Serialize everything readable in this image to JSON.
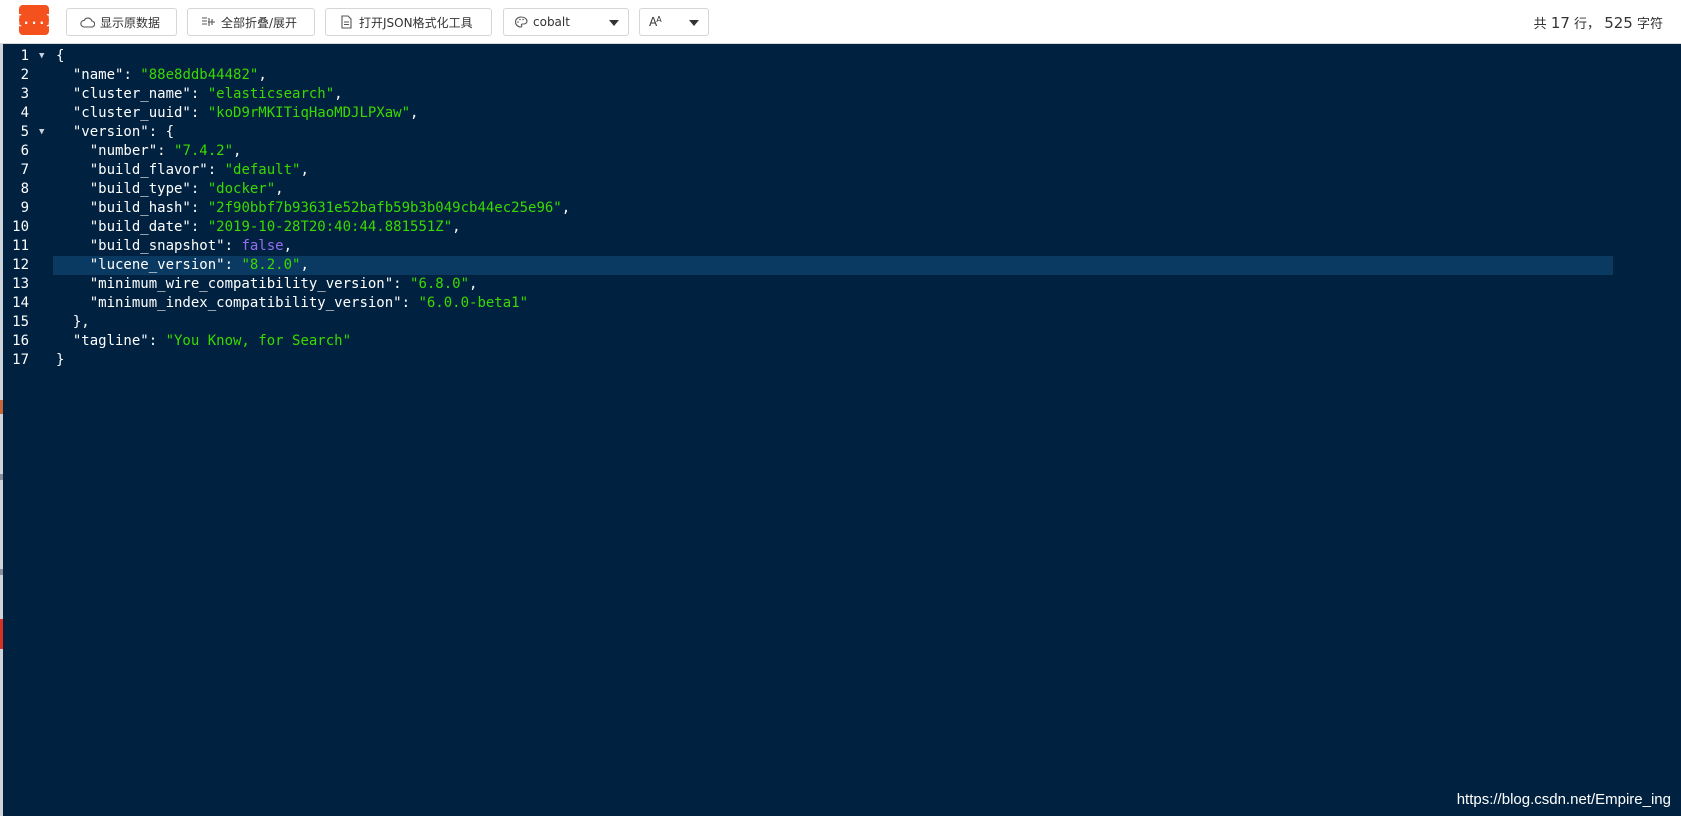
{
  "toolbar": {
    "logo_text": "{...}",
    "show_raw_label": "显示原数据",
    "fold_all_label": "全部折叠/展开",
    "open_tool_label": "打开JSON格式化工具",
    "theme_value": "cobalt",
    "font_value": "A",
    "stats": {
      "prefix": "共",
      "lines": "17",
      "lines_unit": "行，",
      "chars": "525",
      "chars_unit": "字符"
    }
  },
  "editor": {
    "active_line": 12,
    "lines": [
      {
        "n": "1",
        "fold": true,
        "indent": "",
        "parts": [
          {
            "t": "p",
            "v": "{"
          }
        ]
      },
      {
        "n": "2",
        "fold": false,
        "indent": "  ",
        "parts": [
          {
            "t": "k",
            "v": "\"name\""
          },
          {
            "t": "p",
            "v": ": "
          },
          {
            "t": "s",
            "v": "\"88e8ddb44482\""
          },
          {
            "t": "p",
            "v": ","
          }
        ]
      },
      {
        "n": "3",
        "fold": false,
        "indent": "  ",
        "parts": [
          {
            "t": "k",
            "v": "\"cluster_name\""
          },
          {
            "t": "p",
            "v": ": "
          },
          {
            "t": "s",
            "v": "\"elasticsearch\""
          },
          {
            "t": "p",
            "v": ","
          }
        ]
      },
      {
        "n": "4",
        "fold": false,
        "indent": "  ",
        "parts": [
          {
            "t": "k",
            "v": "\"cluster_uuid\""
          },
          {
            "t": "p",
            "v": ": "
          },
          {
            "t": "s",
            "v": "\"koD9rMKITiqHaoMDJLPXaw\""
          },
          {
            "t": "p",
            "v": ","
          }
        ]
      },
      {
        "n": "5",
        "fold": true,
        "indent": "  ",
        "parts": [
          {
            "t": "k",
            "v": "\"version\""
          },
          {
            "t": "p",
            "v": ": {"
          }
        ]
      },
      {
        "n": "6",
        "fold": false,
        "indent": "    ",
        "parts": [
          {
            "t": "k",
            "v": "\"number\""
          },
          {
            "t": "p",
            "v": ": "
          },
          {
            "t": "s",
            "v": "\"7.4.2\""
          },
          {
            "t": "p",
            "v": ","
          }
        ]
      },
      {
        "n": "7",
        "fold": false,
        "indent": "    ",
        "parts": [
          {
            "t": "k",
            "v": "\"build_flavor\""
          },
          {
            "t": "p",
            "v": ": "
          },
          {
            "t": "s",
            "v": "\"default\""
          },
          {
            "t": "p",
            "v": ","
          }
        ]
      },
      {
        "n": "8",
        "fold": false,
        "indent": "    ",
        "parts": [
          {
            "t": "k",
            "v": "\"build_type\""
          },
          {
            "t": "p",
            "v": ": "
          },
          {
            "t": "s",
            "v": "\"docker\""
          },
          {
            "t": "p",
            "v": ","
          }
        ]
      },
      {
        "n": "9",
        "fold": false,
        "indent": "    ",
        "parts": [
          {
            "t": "k",
            "v": "\"build_hash\""
          },
          {
            "t": "p",
            "v": ": "
          },
          {
            "t": "s",
            "v": "\"2f90bbf7b93631e52bafb59b3b049cb44ec25e96\""
          },
          {
            "t": "p",
            "v": ","
          }
        ]
      },
      {
        "n": "10",
        "fold": false,
        "indent": "    ",
        "parts": [
          {
            "t": "k",
            "v": "\"build_date\""
          },
          {
            "t": "p",
            "v": ": "
          },
          {
            "t": "s",
            "v": "\"2019-10-28T20:40:44.881551Z\""
          },
          {
            "t": "p",
            "v": ","
          }
        ]
      },
      {
        "n": "11",
        "fold": false,
        "indent": "    ",
        "parts": [
          {
            "t": "k",
            "v": "\"build_snapshot\""
          },
          {
            "t": "p",
            "v": ": "
          },
          {
            "t": "b",
            "v": "false"
          },
          {
            "t": "p",
            "v": ","
          }
        ]
      },
      {
        "n": "12",
        "fold": false,
        "indent": "    ",
        "parts": [
          {
            "t": "k",
            "v": "\"lucene_version\""
          },
          {
            "t": "p",
            "v": ": "
          },
          {
            "t": "s",
            "v": "\"8.2.0\""
          },
          {
            "t": "p",
            "v": ","
          }
        ]
      },
      {
        "n": "13",
        "fold": false,
        "indent": "    ",
        "parts": [
          {
            "t": "k",
            "v": "\"minimum_wire_compatibility_version\""
          },
          {
            "t": "p",
            "v": ": "
          },
          {
            "t": "s",
            "v": "\"6.8.0\""
          },
          {
            "t": "p",
            "v": ","
          }
        ]
      },
      {
        "n": "14",
        "fold": false,
        "indent": "    ",
        "parts": [
          {
            "t": "k",
            "v": "\"minimum_index_compatibility_version\""
          },
          {
            "t": "p",
            "v": ": "
          },
          {
            "t": "s",
            "v": "\"6.0.0-beta1\""
          }
        ]
      },
      {
        "n": "15",
        "fold": false,
        "indent": "  ",
        "parts": [
          {
            "t": "p",
            "v": "},"
          }
        ]
      },
      {
        "n": "16",
        "fold": false,
        "indent": "  ",
        "parts": [
          {
            "t": "k",
            "v": "\"tagline\""
          },
          {
            "t": "p",
            "v": ": "
          },
          {
            "t": "s",
            "v": "\"You Know, for Search\""
          }
        ]
      },
      {
        "n": "17",
        "fold": false,
        "indent": "",
        "parts": [
          {
            "t": "p",
            "v": "}"
          }
        ]
      }
    ]
  },
  "watermark": "https://blog.csdn.net/Empire_ing",
  "colors": {
    "editor_bg": "#002240",
    "string": "#3ad900",
    "boolean": "#9a6cf5",
    "active_line": "#0a3a61",
    "logo": "#f4511e"
  }
}
